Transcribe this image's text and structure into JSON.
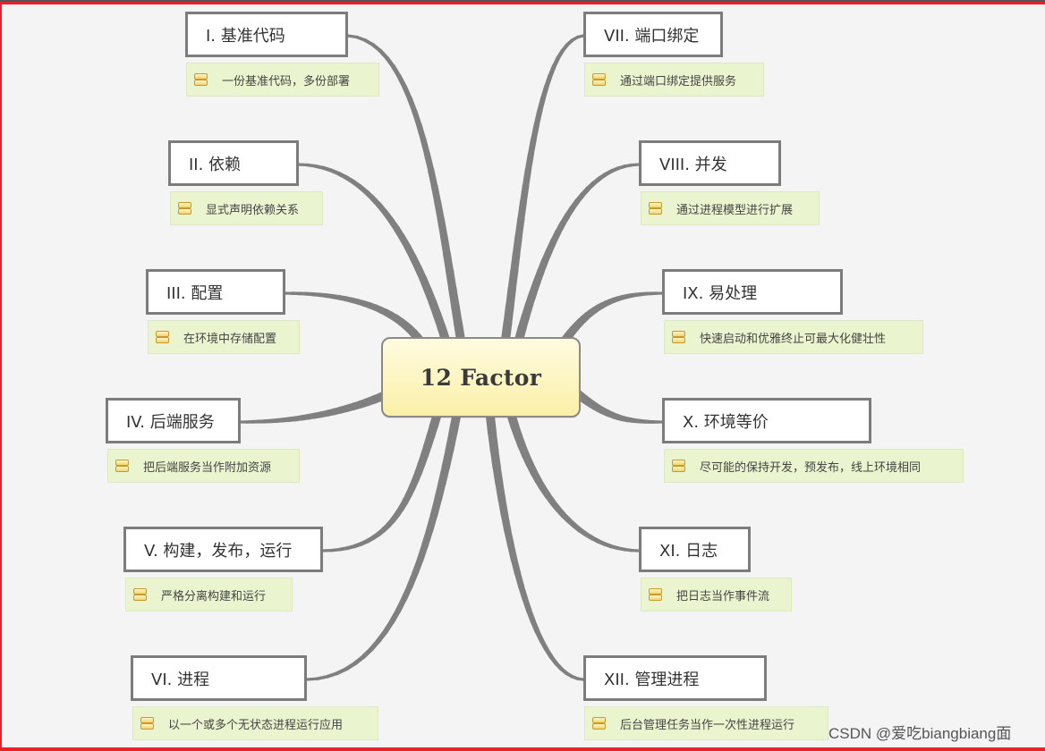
{
  "diagram": {
    "type": "mind-map",
    "center": {
      "label": "12 Factor"
    },
    "branches": [
      {
        "id": "b1",
        "side": "left",
        "title": "I. 基准代码",
        "note": "一份基准代码，多份部署"
      },
      {
        "id": "b2",
        "side": "left",
        "title": "II. 依赖",
        "note": "显式声明依赖关系"
      },
      {
        "id": "b3",
        "side": "left",
        "title": "III. 配置",
        "note": "在环境中存储配置"
      },
      {
        "id": "b4",
        "side": "left",
        "title": "IV. 后端服务",
        "note": "把后端服务当作附加资源"
      },
      {
        "id": "b5",
        "side": "left",
        "title": "V. 构建，发布，运行",
        "note": "严格分离构建和运行"
      },
      {
        "id": "b6",
        "side": "left",
        "title": "VI. 进程",
        "note": "以一个或多个无状态进程运行应用"
      },
      {
        "id": "b7",
        "side": "right",
        "title": "VII. 端口绑定",
        "note": "通过端口绑定提供服务"
      },
      {
        "id": "b8",
        "side": "right",
        "title": "VIII. 并发",
        "note": "通过进程模型进行扩展"
      },
      {
        "id": "b9",
        "side": "right",
        "title": "IX. 易处理",
        "note": "快速启动和优雅终止可最大化健壮性"
      },
      {
        "id": "b10",
        "side": "right",
        "title": "X. 环境等价",
        "note": "尽可能的保持开发，预发布，线上环境相同"
      },
      {
        "id": "b11",
        "side": "right",
        "title": "XI. 日志",
        "note": "把日志当作事件流"
      },
      {
        "id": "b12",
        "side": "right",
        "title": "XII. 管理进程",
        "note": "后台管理任务当作一次性进程运行"
      }
    ],
    "note_icon": "notes-icon"
  },
  "colors": {
    "background": "#f4f4f4",
    "frame": "#e8202a",
    "connector": "#808080",
    "topic_border": "#7c7c7c",
    "note_background": "#eaf5cf",
    "center_fill_top": "#fffbe0",
    "center_fill_bottom": "#fbf0a8"
  },
  "watermark": "CSDN @爱吃biangbiang面"
}
